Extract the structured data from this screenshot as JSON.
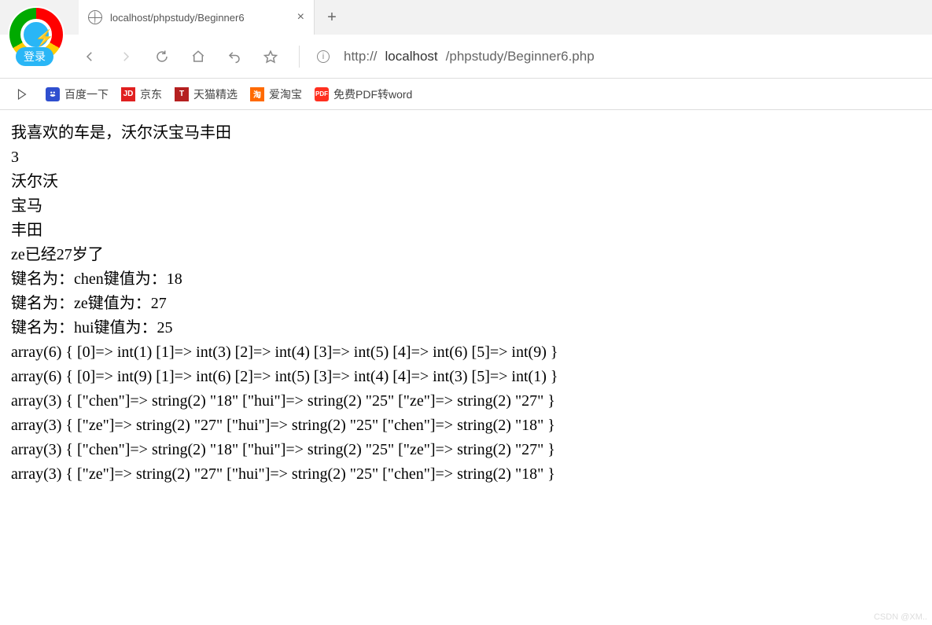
{
  "tab": {
    "title": "localhost/phpstudy/Beginner6"
  },
  "profile": {
    "login_label": "登录"
  },
  "address": {
    "protocol": "http://",
    "host": "localhost",
    "path": "/phpstudy/Beginner6.php"
  },
  "bookmarks": [
    {
      "label": "百度一下",
      "icon_bg": "#2f4fcf",
      "icon_text": ""
    },
    {
      "label": "京东",
      "icon_bg": "#e02020",
      "icon_text": "JD"
    },
    {
      "label": "天猫精选",
      "icon_bg": "#b52020",
      "icon_text": "T"
    },
    {
      "label": "爱淘宝",
      "icon_bg": "#ff6a00",
      "icon_text": "淘"
    },
    {
      "label": "免费PDF转word",
      "icon_bg": "#ff3020",
      "icon_text": "PDF"
    }
  ],
  "page": {
    "lines": [
      "我喜欢的车是，沃尔沃宝马丰田",
      "3",
      "沃尔沃",
      "宝马",
      "丰田",
      "ze已经27岁了",
      "键名为：chen键值为：18",
      "键名为：ze键值为：27",
      "键名为：hui键值为：25",
      "array(6) { [0]=> int(1) [1]=> int(3) [2]=> int(4) [3]=> int(5) [4]=> int(6) [5]=> int(9) }",
      "array(6) { [0]=> int(9) [1]=> int(6) [2]=> int(5) [3]=> int(4) [4]=> int(3) [5]=> int(1) }",
      "array(3) { [\"chen\"]=> string(2) \"18\" [\"hui\"]=> string(2) \"25\" [\"ze\"]=> string(2) \"27\" }",
      "array(3) { [\"ze\"]=> string(2) \"27\" [\"hui\"]=> string(2) \"25\" [\"chen\"]=> string(2) \"18\" }",
      "array(3) { [\"chen\"]=> string(2) \"18\" [\"hui\"]=> string(2) \"25\" [\"ze\"]=> string(2) \"27\" }",
      "array(3) { [\"ze\"]=> string(2) \"27\" [\"hui\"]=> string(2) \"25\" [\"chen\"]=> string(2) \"18\" }"
    ]
  },
  "watermark": "CSDN @XM.."
}
